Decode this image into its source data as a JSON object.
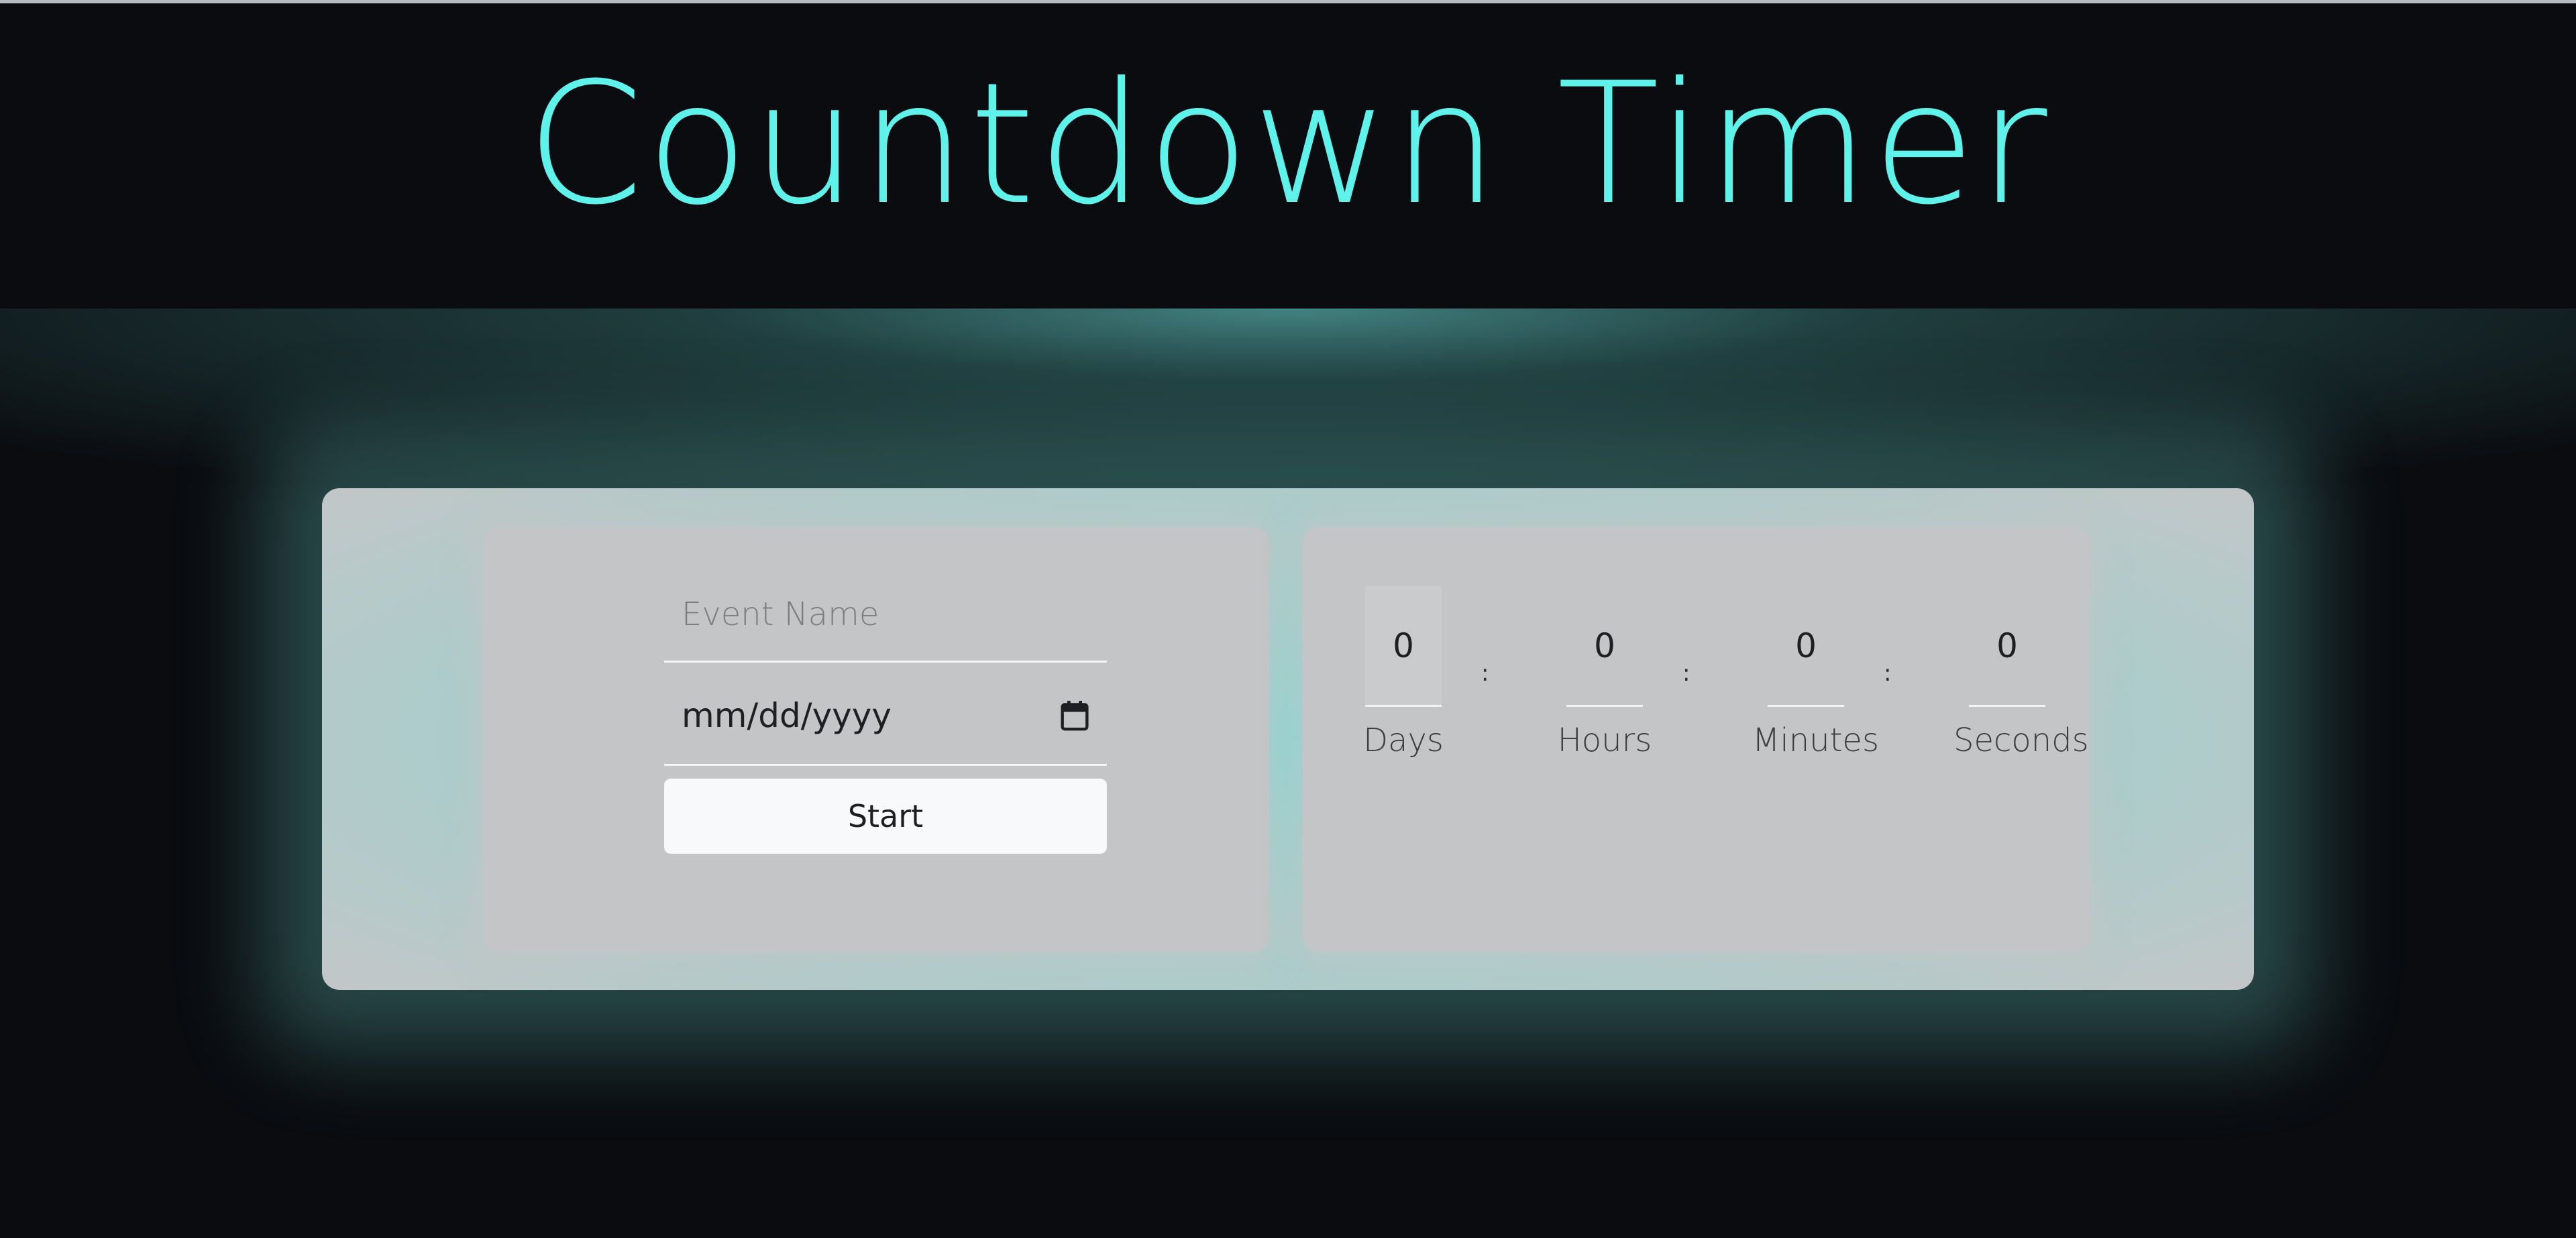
{
  "app": {
    "title": "Countdown Timer"
  },
  "form": {
    "event_name_placeholder": "Event Name",
    "event_name_value": "",
    "date_placeholder": "mm/dd/yyyy",
    "start_label": "Start"
  },
  "countdown": {
    "units": [
      {
        "label": "Days",
        "value": "0"
      },
      {
        "label": "Hours",
        "value": "0"
      },
      {
        "label": "Minutes",
        "value": "0"
      },
      {
        "label": "Seconds",
        "value": "0"
      }
    ],
    "separator": ":"
  },
  "colors": {
    "accent": "#5ff2ea",
    "background": "#0a0c10",
    "card": "#c4c6c8",
    "glow": "#78e1d7"
  },
  "icons": {
    "date_picker": "calendar-icon"
  }
}
